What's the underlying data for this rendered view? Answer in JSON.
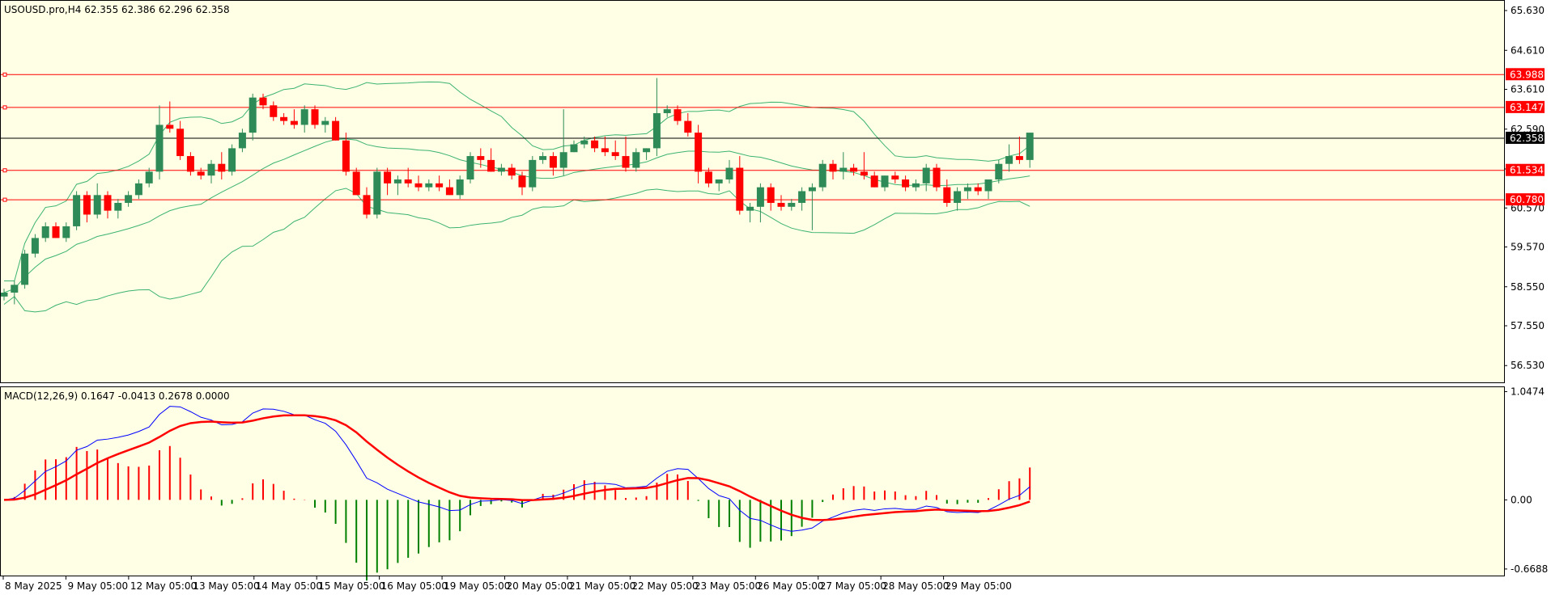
{
  "header": {
    "symbol_line": "USOUSD.pro,H4  62.355 62.386 62.296 62.358",
    "macd_line": "MACD(12,26,9) 0.1647 -0.0413 0.2678 0.0000"
  },
  "colors": {
    "background": "#FFFFE5",
    "bull": "#2E8B57",
    "bear": "#FF0000",
    "bands": "#3CB371",
    "level": "#FF0000",
    "macd_main": "#0000FF",
    "macd_signal": "#FF0000",
    "hist_pos": "#FF0000",
    "hist_neg": "#008000",
    "current_price": "#000000"
  },
  "chart_data": [
    {
      "type": "candlestick",
      "title": "USOUSD.pro,H4",
      "ylim": [
        56.1,
        65.9
      ],
      "price_ticks": [
        "65.630",
        "64.610",
        "63.610",
        "62.590",
        "61.570",
        "60.570",
        "59.570",
        "58.550",
        "57.550",
        "56.530"
      ],
      "x_ticks": [
        "8 May 2025",
        "9 May 05:00",
        "12 May 05:00",
        "13 May 05:00",
        "14 May 05:00",
        "15 May 05:00",
        "16 May 05:00",
        "19 May 05:00",
        "20 May 05:00",
        "21 May 05:00",
        "22 May 05:00",
        "23 May 05:00",
        "26 May 05:00",
        "27 May 05:00",
        "28 May 05:00",
        "29 May 05:00"
      ],
      "levels": [
        {
          "label": "63.988",
          "value": 63.988
        },
        {
          "label": "63.147",
          "value": 63.147
        },
        {
          "label": "61.534",
          "value": 61.534
        },
        {
          "label": "60.780",
          "value": 60.78
        }
      ],
      "current_price": {
        "label": "62.358",
        "value": 62.358
      },
      "ohlc": [
        [
          58.3,
          58.5,
          58.2,
          58.4
        ],
        [
          58.4,
          58.7,
          58.1,
          58.6
        ],
        [
          58.6,
          59.5,
          58.5,
          59.4
        ],
        [
          59.4,
          59.9,
          59.3,
          59.8
        ],
        [
          59.8,
          60.2,
          59.7,
          60.1
        ],
        [
          60.1,
          60.2,
          59.8,
          59.8
        ],
        [
          59.8,
          60.2,
          59.7,
          60.1
        ],
        [
          60.1,
          61.0,
          60.0,
          60.9
        ],
        [
          60.9,
          61.0,
          60.2,
          60.4
        ],
        [
          60.4,
          61.2,
          60.3,
          60.9
        ],
        [
          60.9,
          61.0,
          60.3,
          60.5
        ],
        [
          60.5,
          60.8,
          60.3,
          60.7
        ],
        [
          60.7,
          61.0,
          60.6,
          60.9
        ],
        [
          60.9,
          61.3,
          60.8,
          61.2
        ],
        [
          61.2,
          61.6,
          61.1,
          61.5
        ],
        [
          61.5,
          63.2,
          61.3,
          62.7
        ],
        [
          62.7,
          63.3,
          62.5,
          62.6
        ],
        [
          62.6,
          62.8,
          61.8,
          61.9
        ],
        [
          61.9,
          62.0,
          61.4,
          61.5
        ],
        [
          61.5,
          61.6,
          61.3,
          61.4
        ],
        [
          61.4,
          61.8,
          61.2,
          61.7
        ],
        [
          61.7,
          62.0,
          61.3,
          61.5
        ],
        [
          61.5,
          62.2,
          61.4,
          62.1
        ],
        [
          62.1,
          62.6,
          62.0,
          62.5
        ],
        [
          62.5,
          63.5,
          62.3,
          63.4
        ],
        [
          63.4,
          63.5,
          63.1,
          63.2
        ],
        [
          63.2,
          63.3,
          62.8,
          62.9
        ],
        [
          62.9,
          63.0,
          62.7,
          62.8
        ],
        [
          62.8,
          63.1,
          62.6,
          62.7
        ],
        [
          62.7,
          63.2,
          62.5,
          63.1
        ],
        [
          63.1,
          63.2,
          62.6,
          62.7
        ],
        [
          62.7,
          62.9,
          62.5,
          62.8
        ],
        [
          62.8,
          62.9,
          62.3,
          62.3
        ],
        [
          62.3,
          62.5,
          61.4,
          61.5
        ],
        [
          61.5,
          61.6,
          60.9,
          60.9
        ],
        [
          60.9,
          61.1,
          60.3,
          60.4
        ],
        [
          60.4,
          61.6,
          60.3,
          61.5
        ],
        [
          61.5,
          61.6,
          60.9,
          61.2
        ],
        [
          61.2,
          61.4,
          60.9,
          61.3
        ],
        [
          61.3,
          61.6,
          61.1,
          61.2
        ],
        [
          61.2,
          61.4,
          61.0,
          61.1
        ],
        [
          61.1,
          61.3,
          61.0,
          61.2
        ],
        [
          61.2,
          61.4,
          61.0,
          61.1
        ],
        [
          61.1,
          61.3,
          60.9,
          60.9
        ],
        [
          60.9,
          61.4,
          60.8,
          61.3
        ],
        [
          61.3,
          62.0,
          61.2,
          61.9
        ],
        [
          61.9,
          62.1,
          61.6,
          61.8
        ],
        [
          61.8,
          62.1,
          61.5,
          61.5
        ],
        [
          61.5,
          61.7,
          61.4,
          61.6
        ],
        [
          61.6,
          61.7,
          61.3,
          61.4
        ],
        [
          61.4,
          61.5,
          60.9,
          61.1
        ],
        [
          61.1,
          61.9,
          61.0,
          61.8
        ],
        [
          61.8,
          62.0,
          61.7,
          61.9
        ],
        [
          61.9,
          62.0,
          61.4,
          61.6
        ],
        [
          61.6,
          63.1,
          61.4,
          62.0
        ],
        [
          62.0,
          62.3,
          62.0,
          62.2
        ],
        [
          62.2,
          62.4,
          62.1,
          62.3
        ],
        [
          62.3,
          62.4,
          62.0,
          62.1
        ],
        [
          62.1,
          62.4,
          61.9,
          62.0
        ],
        [
          62.0,
          62.3,
          61.8,
          61.9
        ],
        [
          61.9,
          62.4,
          61.5,
          61.6
        ],
        [
          61.6,
          62.1,
          61.5,
          62.0
        ],
        [
          62.0,
          62.1,
          61.8,
          62.1
        ],
        [
          62.1,
          63.9,
          61.9,
          63.0
        ],
        [
          63.0,
          63.2,
          62.9,
          63.1
        ],
        [
          63.1,
          63.2,
          62.7,
          62.8
        ],
        [
          62.8,
          63.0,
          62.4,
          62.5
        ],
        [
          62.5,
          62.7,
          61.2,
          61.5
        ],
        [
          61.5,
          61.6,
          61.1,
          61.2
        ],
        [
          61.2,
          61.3,
          61.0,
          61.3
        ],
        [
          61.3,
          61.8,
          61.2,
          61.6
        ],
        [
          61.6,
          61.9,
          60.4,
          60.5
        ],
        [
          60.5,
          60.7,
          60.2,
          60.6
        ],
        [
          60.6,
          61.2,
          60.2,
          61.1
        ],
        [
          61.1,
          61.2,
          60.5,
          60.7
        ],
        [
          60.7,
          60.9,
          60.5,
          60.6
        ],
        [
          60.6,
          60.8,
          60.5,
          60.7
        ],
        [
          60.7,
          61.1,
          60.5,
          61.0
        ],
        [
          61.0,
          61.2,
          60.0,
          61.1
        ],
        [
          61.1,
          61.8,
          61.0,
          61.7
        ],
        [
          61.7,
          61.8,
          61.3,
          61.5
        ],
        [
          61.5,
          62.0,
          61.3,
          61.6
        ],
        [
          61.6,
          61.7,
          61.4,
          61.5
        ],
        [
          61.5,
          62.0,
          61.3,
          61.4
        ],
        [
          61.4,
          61.5,
          61.1,
          61.1
        ],
        [
          61.1,
          61.4,
          61.0,
          61.4
        ],
        [
          61.4,
          61.5,
          61.2,
          61.3
        ],
        [
          61.3,
          61.4,
          61.0,
          61.1
        ],
        [
          61.1,
          61.3,
          61.0,
          61.2
        ],
        [
          61.2,
          61.7,
          61.0,
          61.6
        ],
        [
          61.6,
          61.7,
          61.0,
          61.1
        ],
        [
          61.1,
          61.3,
          60.6,
          60.7
        ],
        [
          60.7,
          61.1,
          60.5,
          61.0
        ],
        [
          61.0,
          61.2,
          60.8,
          61.1
        ],
        [
          61.1,
          61.2,
          60.9,
          61.0
        ],
        [
          61.0,
          61.3,
          60.8,
          61.3
        ],
        [
          61.3,
          61.8,
          61.2,
          61.7
        ],
        [
          61.7,
          62.2,
          61.5,
          61.9
        ],
        [
          61.9,
          62.4,
          61.7,
          61.8
        ],
        [
          61.8,
          62.5,
          61.6,
          62.5
        ]
      ]
    },
    {
      "type": "macd",
      "title": "MACD(12,26,9)",
      "params": [
        12,
        26,
        9
      ],
      "readout": [
        0.1647,
        -0.0413,
        0.2678,
        0.0
      ],
      "ylim": [
        -0.74,
        1.09
      ],
      "y_ticks": [
        "1.0474",
        "0.00",
        "-0.6688"
      ]
    }
  ]
}
